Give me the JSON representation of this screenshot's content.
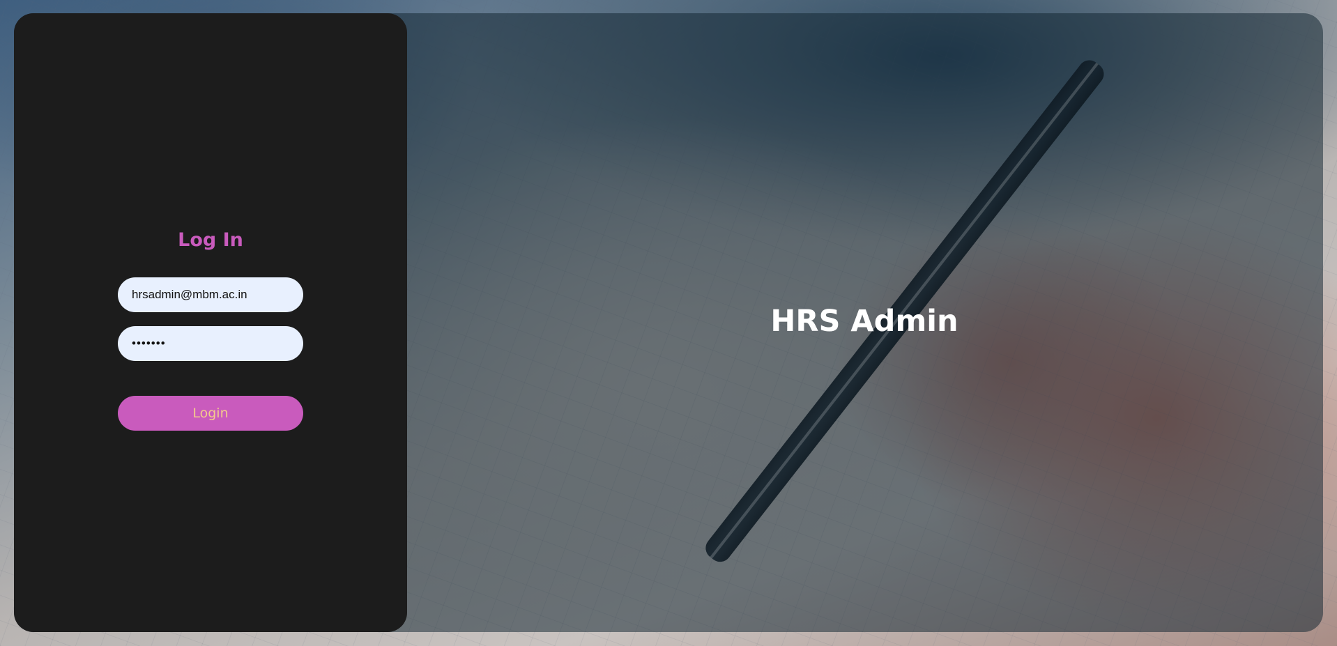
{
  "login": {
    "title": "Log In",
    "email_value": "hrsadmin@mbm.ac.in",
    "password_value": "1234567",
    "button_label": "Login"
  },
  "brand": {
    "title": "HRS Admin"
  },
  "colors": {
    "accent": "#c95bbd",
    "button_text": "#f3c98d",
    "panel_bg": "#1c1c1c",
    "input_bg": "#e8f0fe"
  }
}
